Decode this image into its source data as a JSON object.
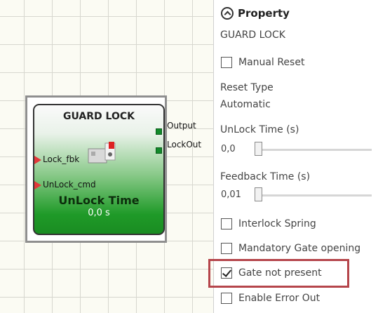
{
  "block": {
    "title": "GUARD LOCK",
    "inputs": [
      "Lock_fbk",
      "UnLock_cmd"
    ],
    "outputs": [
      "Output",
      "LockOut"
    ],
    "function_name": "UnLock Time",
    "function_value": "0,0 s"
  },
  "panel": {
    "header": "Property",
    "element_name": "GUARD LOCK",
    "manual_reset": {
      "label": "Manual Reset",
      "checked": false
    },
    "reset_type_label": "Reset Type",
    "reset_type_value": "Automatic",
    "unlock_time": {
      "label": "UnLock Time (s)",
      "value": "0,0"
    },
    "feedback_time": {
      "label": "Feedback Time (s)",
      "value": "0,01"
    },
    "interlock_spring": {
      "label": "Interlock Spring",
      "checked": false
    },
    "mandatory_gate": {
      "label": "Mandatory Gate opening",
      "checked": false
    },
    "gate_not_present": {
      "label": "Gate not present",
      "checked": true
    },
    "enable_error_out": {
      "label": "Enable Error Out",
      "checked": false
    }
  },
  "colors": {
    "highlight": "#b5454b",
    "input_arrow": "#e3383a",
    "output_port": "#118a2a"
  }
}
